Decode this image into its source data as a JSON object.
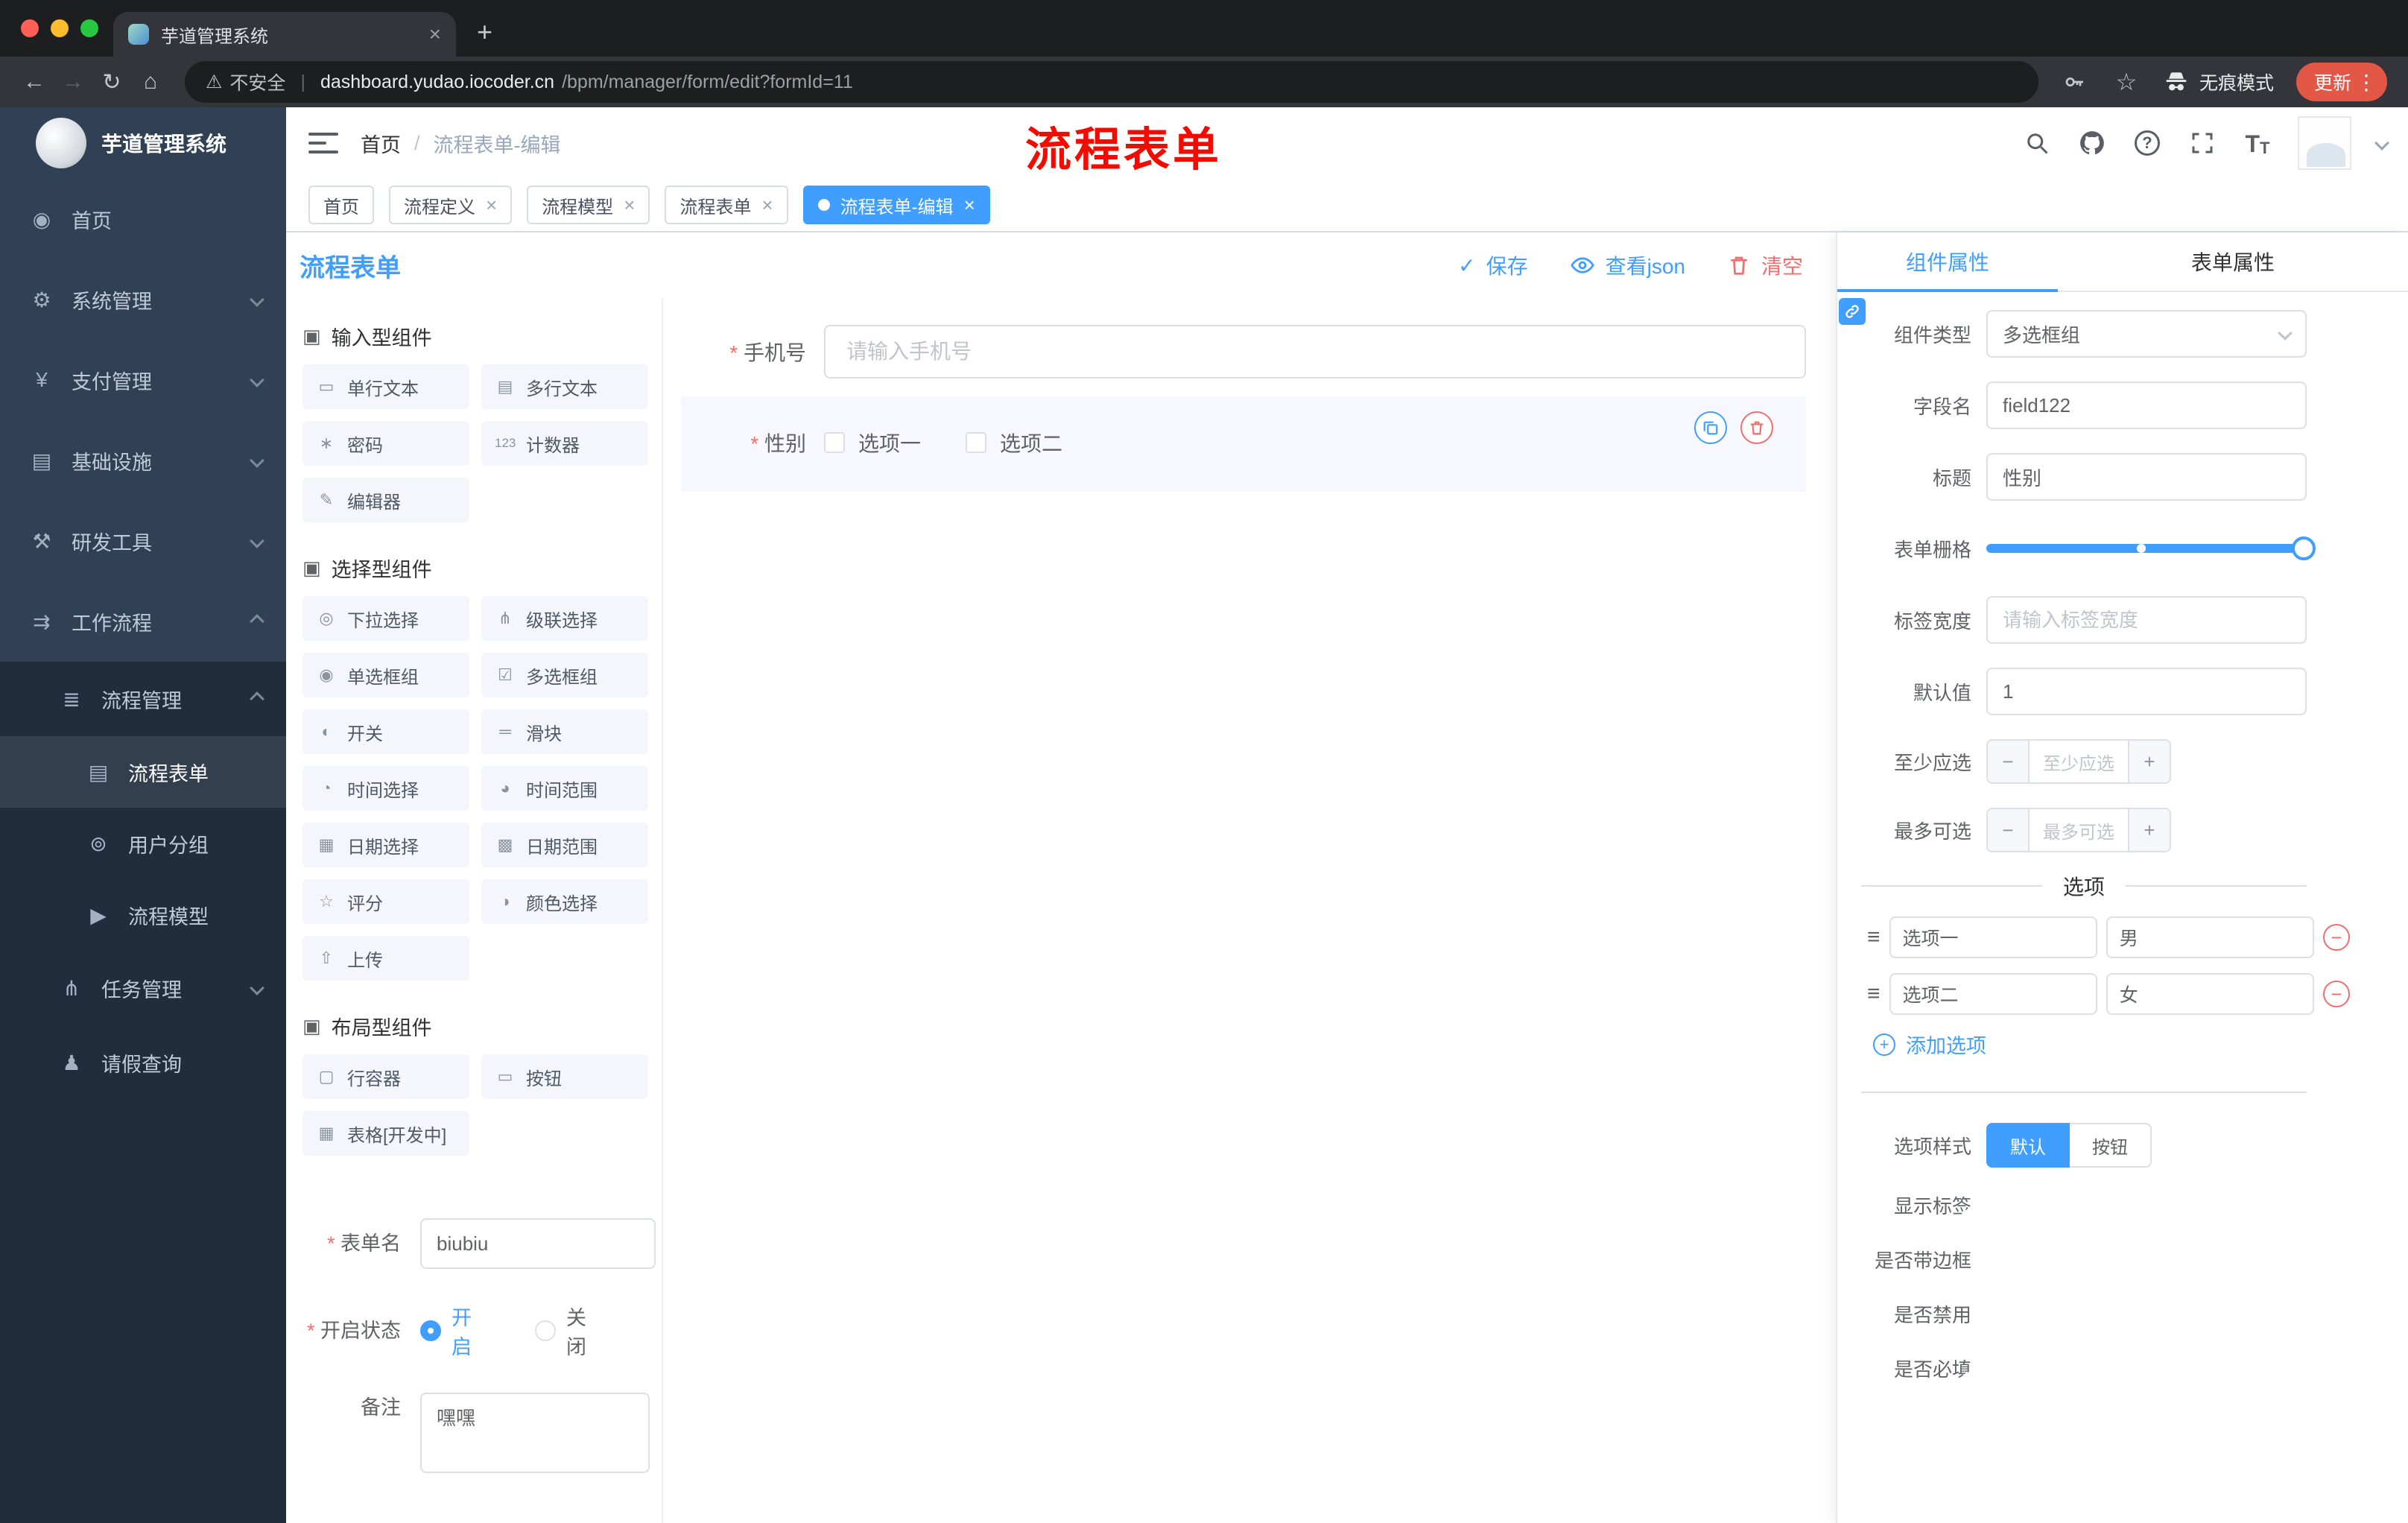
{
  "colors": {
    "accent": "#409eff",
    "danger": "#f56c6c",
    "annotation": "#f40b00",
    "sidebar_bg": "#304156",
    "submenu_bg": "#1f2d3d",
    "active_tag": "#409eff"
  },
  "icons": {
    "close": "×",
    "back": "←",
    "forward": "→",
    "reload": "↻",
    "home": "⌂",
    "warning": "⚠",
    "divider": "|",
    "star": "☆",
    "kebab": "⋮",
    "plus_tab": "+",
    "check": "✓",
    "question": "?",
    "text_size": "T",
    "section": "▣",
    "drag": "≡",
    "minus": "−",
    "plus": "+"
  },
  "browser": {
    "tab_title": "芋道管理系统",
    "security_label": "不安全",
    "url_host": "dashboard.yudao.iocoder.cn",
    "url_path": "/bpm/manager/form/edit?formId=11",
    "incognito_label": "无痕模式",
    "update_label": "更新"
  },
  "sidebar": {
    "logo_title": "芋道管理系统",
    "top_items": [
      {
        "label": "首页",
        "icon": "◉"
      },
      {
        "label": "系统管理",
        "icon": "⚙"
      },
      {
        "label": "支付管理",
        "icon": "¥"
      },
      {
        "label": "基础设施",
        "icon": "▤"
      },
      {
        "label": "研发工具",
        "icon": "⚒"
      },
      {
        "label": "工作流程",
        "icon": "⇉"
      }
    ],
    "sub_items": [
      {
        "label": "流程管理",
        "icon": "≣"
      },
      {
        "label": "流程表单",
        "icon": "▤"
      },
      {
        "label": "用户分组",
        "icon": "⊚"
      },
      {
        "label": "流程模型",
        "icon": "▶"
      },
      {
        "label": "任务管理",
        "icon": "⋔"
      },
      {
        "label": "请假查询",
        "icon": "♟"
      }
    ]
  },
  "header": {
    "breadcrumb": [
      "首页",
      "流程表单-编辑"
    ],
    "breadcrumb_separator": "/",
    "annotation": "流程表单"
  },
  "tags": [
    {
      "label": "首页"
    },
    {
      "label": "流程定义"
    },
    {
      "label": "流程模型"
    },
    {
      "label": "流程表单"
    },
    {
      "label": "流程表单-编辑"
    }
  ],
  "page": {
    "title": "流程表单",
    "save": "保存",
    "view_json": "查看json",
    "clear": "清空"
  },
  "palette": {
    "sections": [
      {
        "title": "输入型组件",
        "items": [
          {
            "label": "单行文本",
            "icon": "▭"
          },
          {
            "label": "多行文本",
            "icon": "▤"
          },
          {
            "label": "密码",
            "icon": "∗"
          },
          {
            "label": "计数器",
            "icon": "123"
          },
          {
            "label": "编辑器",
            "icon": "✎"
          }
        ]
      },
      {
        "title": "选择型组件",
        "items": [
          {
            "label": "下拉选择",
            "icon": "◎"
          },
          {
            "label": "级联选择",
            "icon": "⋔"
          },
          {
            "label": "单选框组",
            "icon": "◉"
          },
          {
            "label": "多选框组",
            "icon": "☑"
          },
          {
            "label": "开关",
            "icon": "◐"
          },
          {
            "label": "滑块",
            "icon": "═"
          },
          {
            "label": "时间选择",
            "icon": "◔"
          },
          {
            "label": "时间范围",
            "icon": "◕"
          },
          {
            "label": "日期选择",
            "icon": "▦"
          },
          {
            "label": "日期范围",
            "icon": "▩"
          },
          {
            "label": "评分",
            "icon": "☆"
          },
          {
            "label": "颜色选择",
            "icon": "◑"
          },
          {
            "label": "上传",
            "icon": "⇧"
          }
        ]
      },
      {
        "title": "布局型组件",
        "items": [
          {
            "label": "行容器",
            "icon": "▢"
          },
          {
            "label": "按钮",
            "icon": "▭"
          },
          {
            "label": "表格[开发中]",
            "icon": "▦"
          }
        ]
      }
    ],
    "form": {
      "name_label": "表单名",
      "name_value": "biubiu",
      "status_label": "开启状态",
      "status_on": "开启",
      "status_off": "关闭",
      "remark_label": "备注",
      "remark_value": "嘿嘿"
    }
  },
  "canvas": {
    "phone_label": "手机号",
    "phone_placeholder": "请输入手机号",
    "gender_label": "性别",
    "gender_options": [
      "选项一",
      "选项二"
    ]
  },
  "inspector": {
    "tab_component": "组件属性",
    "tab_form": "表单属性",
    "rows": {
      "component_type": {
        "label": "组件类型",
        "value": "多选框组"
      },
      "field_name": {
        "label": "字段名",
        "value": "field122"
      },
      "title": {
        "label": "标题",
        "value": "性别"
      },
      "grid": {
        "label": "表单栅格"
      },
      "label_width": {
        "label": "标签宽度",
        "placeholder": "请输入标签宽度"
      },
      "default_value": {
        "label": "默认值",
        "value": "1"
      },
      "min_select": {
        "label": "至少应选",
        "placeholder": "至少应选"
      },
      "max_select": {
        "label": "最多可选",
        "placeholder": "最多可选"
      }
    },
    "options_title": "选项",
    "options": [
      {
        "label": "选项一",
        "value": "男"
      },
      {
        "label": "选项二",
        "value": "女"
      }
    ],
    "add_option": "添加选项",
    "style": {
      "label": "选项样式",
      "default": "默认",
      "button": "按钮"
    },
    "switches": [
      {
        "label": "显示标签",
        "on": true
      },
      {
        "label": "是否带边框",
        "on": false
      },
      {
        "label": "是否禁用",
        "on": false
      },
      {
        "label": "是否必填",
        "on": true
      }
    ]
  }
}
